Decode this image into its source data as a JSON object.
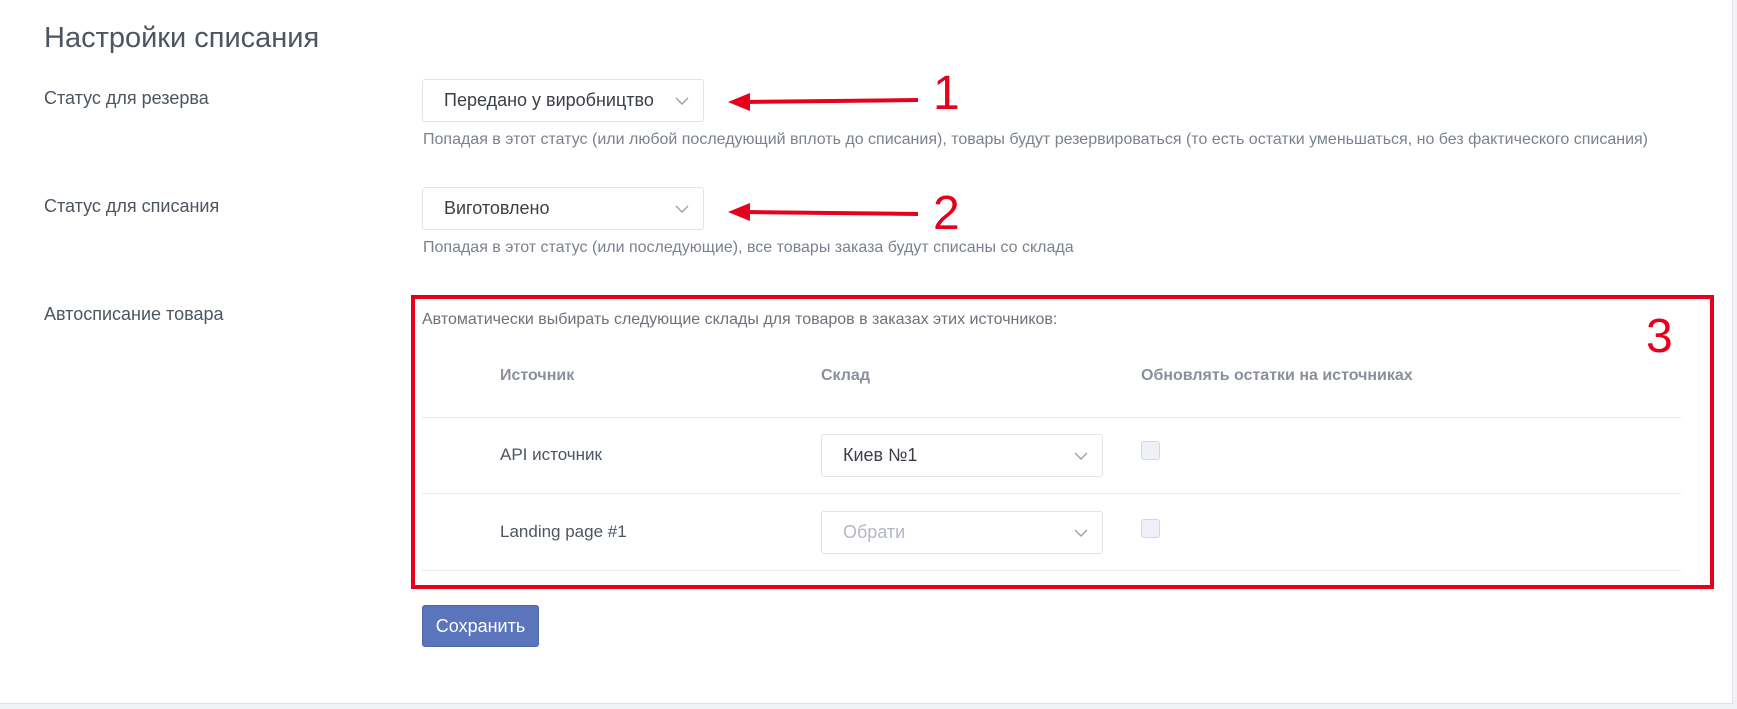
{
  "page": {
    "title": "Настройки списания"
  },
  "reserve": {
    "label": "Статус для резерва",
    "value": "Передано у виробництво",
    "hint": "Попадая в этот статус (или любой последующий вплоть до списания), товары будут резервироваться (то есть остатки уменьшаться, но без фактического списания)"
  },
  "writeoff": {
    "label": "Статус для списания",
    "value": "Виготовлено",
    "hint": "Попадая в этот статус (или последующие), все товары заказа будут списаны со склада"
  },
  "autowriteoff": {
    "label": "Автосписание товара",
    "hint": "Автоматически выбирать следующие склады для товаров в заказах этих источников:",
    "columns": [
      "Источник",
      "Склад",
      "Обновлять остатки на источниках"
    ],
    "rows": [
      {
        "source": "API источник",
        "warehouse": "Киев №1",
        "placeholder": false,
        "update": false
      },
      {
        "source": "Landing page #1",
        "warehouse": "Обрати",
        "placeholder": true,
        "update": false
      }
    ]
  },
  "save_label": "Сохранить",
  "annotations": [
    "1",
    "2",
    "3"
  ],
  "colors": {
    "annotation": "#e6001b",
    "primary_button": "#5a75bb"
  }
}
